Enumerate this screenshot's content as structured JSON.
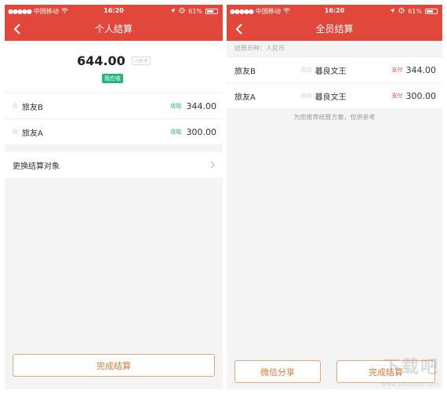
{
  "status_bar": {
    "carrier": "中国移动",
    "time": "16:20",
    "battery": "61%"
  },
  "left": {
    "title": "个人结算",
    "total_amount": "644.00",
    "currency_tag": "人民币",
    "receive_badge": "我应收",
    "rows": [
      {
        "prefix": "向",
        "name": "旅友B",
        "tag": "收取",
        "value": "344.00"
      },
      {
        "prefix": "向",
        "name": "旅友A",
        "tag": "收取",
        "value": "300.00"
      }
    ],
    "change_target_label": "更换结算对象",
    "finish_button": "完成结算"
  },
  "right": {
    "title": "全员结算",
    "currency_line": "结算币种：人民币",
    "rows": [
      {
        "name": "旅友B",
        "mid_prefix": "应向",
        "target": "暮良文王",
        "tag": "支付",
        "value": "344.00"
      },
      {
        "name": "旅友A",
        "mid_prefix": "应向",
        "target": "暮良文王",
        "tag": "支付",
        "value": "300.00"
      }
    ],
    "hint": "为您推荐结算方案，仅供参考",
    "share_button": "微信分享",
    "finish_button": "完成结算"
  },
  "watermark": {
    "text": "下载吧",
    "url": "www.xiazaiba.com"
  },
  "colors": {
    "brand_red": "#e2473c",
    "green": "#25b578",
    "orange": "#e07a37"
  },
  "icons": [
    "back-arrow-icon",
    "chevron-right-icon",
    "wifi-icon",
    "location-icon",
    "alarm-icon",
    "battery-icon"
  ]
}
